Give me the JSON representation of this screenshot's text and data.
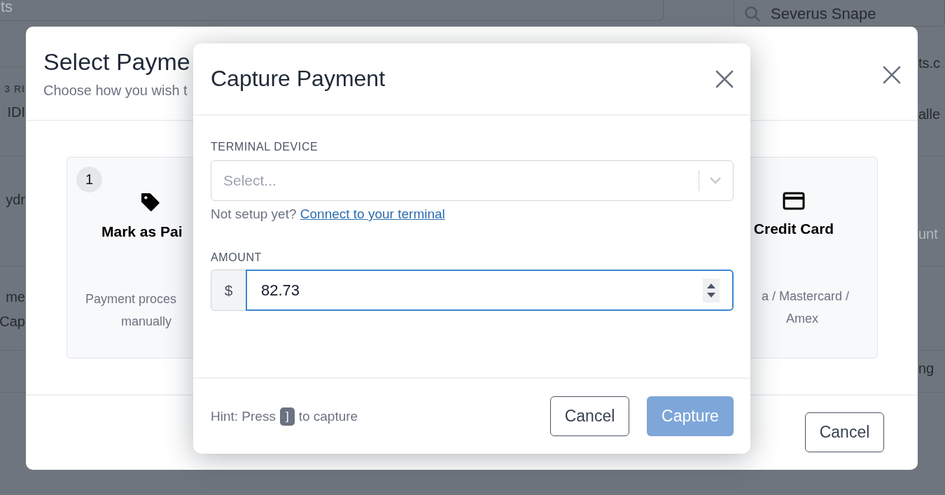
{
  "background": {
    "top_field": {
      "placeholder": "ts"
    },
    "search_field": {
      "value": "Severus Snape"
    },
    "left_fragments": [
      {
        "text": "3 RI",
        "kind": "tag"
      },
      {
        "text": "IDI",
        "kind": "text"
      },
      {
        "text": "ydr",
        "kind": "text"
      },
      {
        "text": "me",
        "kind": "text"
      },
      {
        "text": "Cap",
        "kind": "text"
      }
    ],
    "right_fragments": [
      {
        "text": "ts.c",
        "kind": "text"
      },
      {
        "text": "alle",
        "kind": "text"
      },
      {
        "text": "unt",
        "kind": "placeholder"
      },
      {
        "text": "ng",
        "kind": "text"
      }
    ]
  },
  "select_dialog": {
    "title": "Select Payme",
    "subtitle": "Choose how you wish t",
    "methods": [
      {
        "kind": "tag",
        "number": "1",
        "title": "Mark as Pai",
        "description": [
          "Payment proces",
          "manually"
        ]
      },
      {
        "kind": "card",
        "title": "Credit Card",
        "description": [
          "a / Mastercard /",
          "Amex"
        ]
      }
    ],
    "cancel": "Cancel"
  },
  "capture_dialog": {
    "title": "Capture Payment",
    "terminal": {
      "label": "TERMINAL DEVICE",
      "placeholder": "Select..."
    },
    "setup_hint": {
      "text": "Not setup yet?",
      "link": "Connect to your terminal"
    },
    "amount": {
      "label": "AMOUNT",
      "prefix": "$",
      "value": "82.73",
      "focused": true
    },
    "hint": {
      "before": "Hint: Press",
      "key": "]",
      "after": "to capture"
    },
    "buttons": [
      {
        "label": "Cancel",
        "kind": "secondary",
        "disabled": false
      },
      {
        "label": "Capture",
        "kind": "primary",
        "disabled": true
      }
    ]
  }
}
